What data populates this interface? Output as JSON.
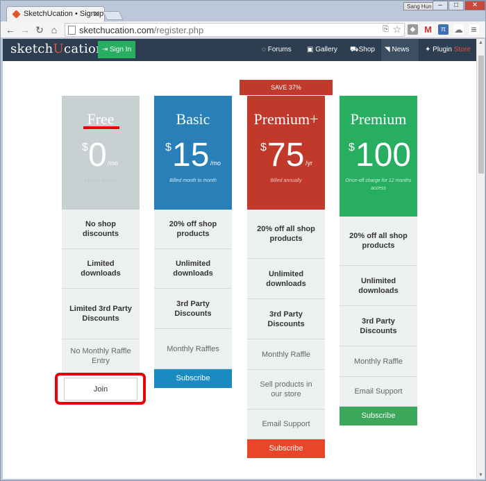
{
  "browser": {
    "tab_title": "SketchUcation • Signup",
    "user_badge": "Sang Hun",
    "url_host": "sketchucation.com",
    "url_path": "/register.php"
  },
  "site_nav": {
    "logo_pre": "sketch",
    "logo_accent": "U",
    "logo_post": "cation",
    "signin_label": "Sign In",
    "links": [
      {
        "label": "Forums",
        "icon": "chat-icon"
      },
      {
        "label": "Gallery",
        "icon": "image-icon"
      },
      {
        "label": "Shop",
        "icon": "cart-icon"
      },
      {
        "label": "News",
        "icon": "rss-icon"
      },
      {
        "label": "Plugin",
        "icon": "puzzle-icon",
        "suffix": "Store"
      }
    ]
  },
  "pricing": {
    "save_banner": "SAVE 37%",
    "plans": [
      {
        "name": "Free",
        "currency": "$",
        "amount": "0",
        "unit": "/mo",
        "note": "Limited Access",
        "color": "#c8d0d2",
        "features": [
          "No shop discounts",
          "Limited downloads",
          "Limited 3rd Party Discounts",
          "No Monthly Raffle Entry"
        ],
        "button": "Join",
        "button_color": "#e6e6e6"
      },
      {
        "name": "Basic",
        "currency": "$",
        "amount": "15",
        "unit": "/mo",
        "note": "Billed month to month",
        "color": "#2980b9",
        "features": [
          "20% off shop products",
          "Unlimited downloads",
          "3rd Party Discounts",
          "Monthly Raffles"
        ],
        "button": "Subscribe",
        "button_color": "#1a8bc1"
      },
      {
        "name": "Premium+",
        "currency": "$",
        "amount": "75",
        "unit": "/yr",
        "note": "Billed annually",
        "color": "#c0392b",
        "features": [
          "20% off all shop products",
          "Unlimited downloads",
          "3rd Party Discounts",
          "Monthly Raffle",
          "Sell products in our store",
          "Email Support"
        ],
        "button": "Subscribe",
        "button_color": "#e8452b"
      },
      {
        "name": "Premium",
        "currency": "$",
        "amount": "100",
        "unit": "",
        "note": "Once-off charge for 12 months access",
        "color": "#27ae60",
        "features": [
          "20% off all shop products",
          "Unlimited downloads",
          "3rd Party Discounts",
          "Monthly Raffle",
          "Email Support"
        ],
        "button": "Subscribe",
        "button_color": "#3aa75a"
      }
    ]
  }
}
